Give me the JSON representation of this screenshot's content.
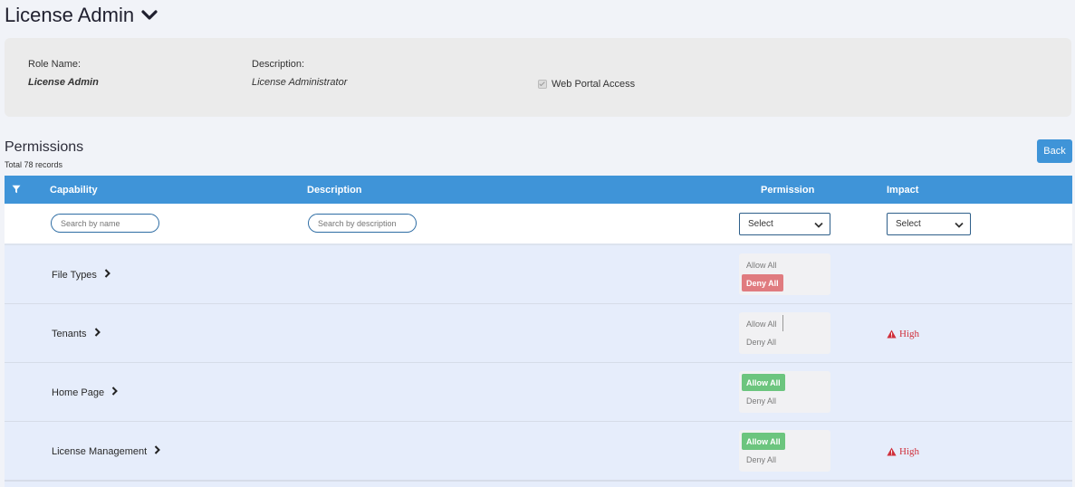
{
  "header": {
    "title": "License Admin"
  },
  "role": {
    "name_label": "Role Name:",
    "name_value": "License Admin",
    "description_label": "Description:",
    "description_value": "License Administrator",
    "web_portal_label": "Web Portal Access",
    "web_portal_checked": true
  },
  "permissions": {
    "title": "Permissions",
    "count_text": "Total 78 records",
    "back_label": "Back",
    "columns": {
      "capability": "Capability",
      "description": "Description",
      "permission": "Permission",
      "impact": "Impact"
    },
    "filters": {
      "name_placeholder": "Search by name",
      "description_placeholder": "Search by description",
      "permission_select": "Select",
      "impact_select": "Select"
    },
    "rows": [
      {
        "capability": "File Types",
        "allow_label": "Allow All",
        "deny_label": "Deny All",
        "selected": "deny",
        "impact": ""
      },
      {
        "capability": "Tenants",
        "allow_label": "Allow All",
        "deny_label": "Deny All",
        "selected": "none",
        "impact": "High"
      },
      {
        "capability": "Home Page",
        "allow_label": "Allow All",
        "deny_label": "Deny All",
        "selected": "allow",
        "impact": ""
      },
      {
        "capability": "License Management",
        "allow_label": "Allow All",
        "deny_label": "Deny All",
        "selected": "allow",
        "impact": "High"
      }
    ]
  },
  "colors": {
    "header_blue": "#3f94d8",
    "row_bg": "#e6edfb",
    "allow_green": "#6cc57e",
    "deny_red": "#e07b7f",
    "impact_red": "#d0303b"
  },
  "icons": {
    "title_toggle": "chevron-down-icon",
    "filter": "filter-icon",
    "expand": "chevron-right-icon",
    "impact": "warning-icon",
    "dropdown": "chevron-down-icon"
  }
}
